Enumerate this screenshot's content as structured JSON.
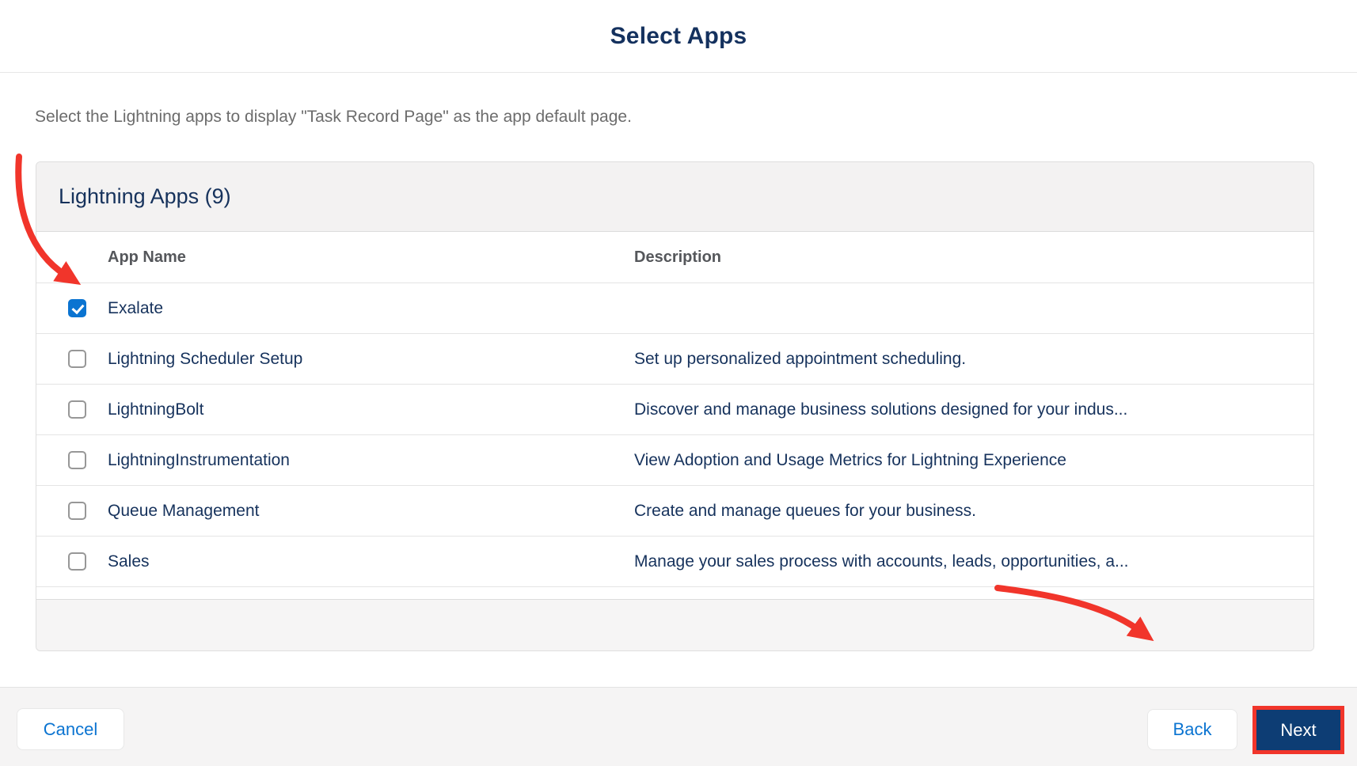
{
  "header": {
    "title": "Select Apps"
  },
  "instruction": "Select the Lightning apps to display \"Task Record Page\" as the app default page.",
  "card": {
    "title": "Lightning Apps (9)",
    "columns": {
      "app_name": "App Name",
      "description": "Description"
    },
    "rows": [
      {
        "name": "Exalate",
        "description": "",
        "checked": true
      },
      {
        "name": "Lightning Scheduler Setup",
        "description": "Set up personalized appointment scheduling.",
        "checked": false
      },
      {
        "name": "LightningBolt",
        "description": "Discover and manage business solutions designed for your indus...",
        "checked": false
      },
      {
        "name": "LightningInstrumentation",
        "description": "View Adoption and Usage Metrics for Lightning Experience",
        "checked": false
      },
      {
        "name": "Queue Management",
        "description": "Create and manage queues for your business.",
        "checked": false
      },
      {
        "name": "Sales",
        "description": "Manage your sales process with accounts, leads, opportunities, a...",
        "checked": false
      }
    ]
  },
  "footer": {
    "cancel_label": "Cancel",
    "back_label": "Back",
    "next_label": "Next"
  },
  "colors": {
    "accent_blue": "#0b74d1",
    "navy_text": "#16325c",
    "next_button_bg": "#0d3d74",
    "annotation_red": "#f1352b"
  }
}
